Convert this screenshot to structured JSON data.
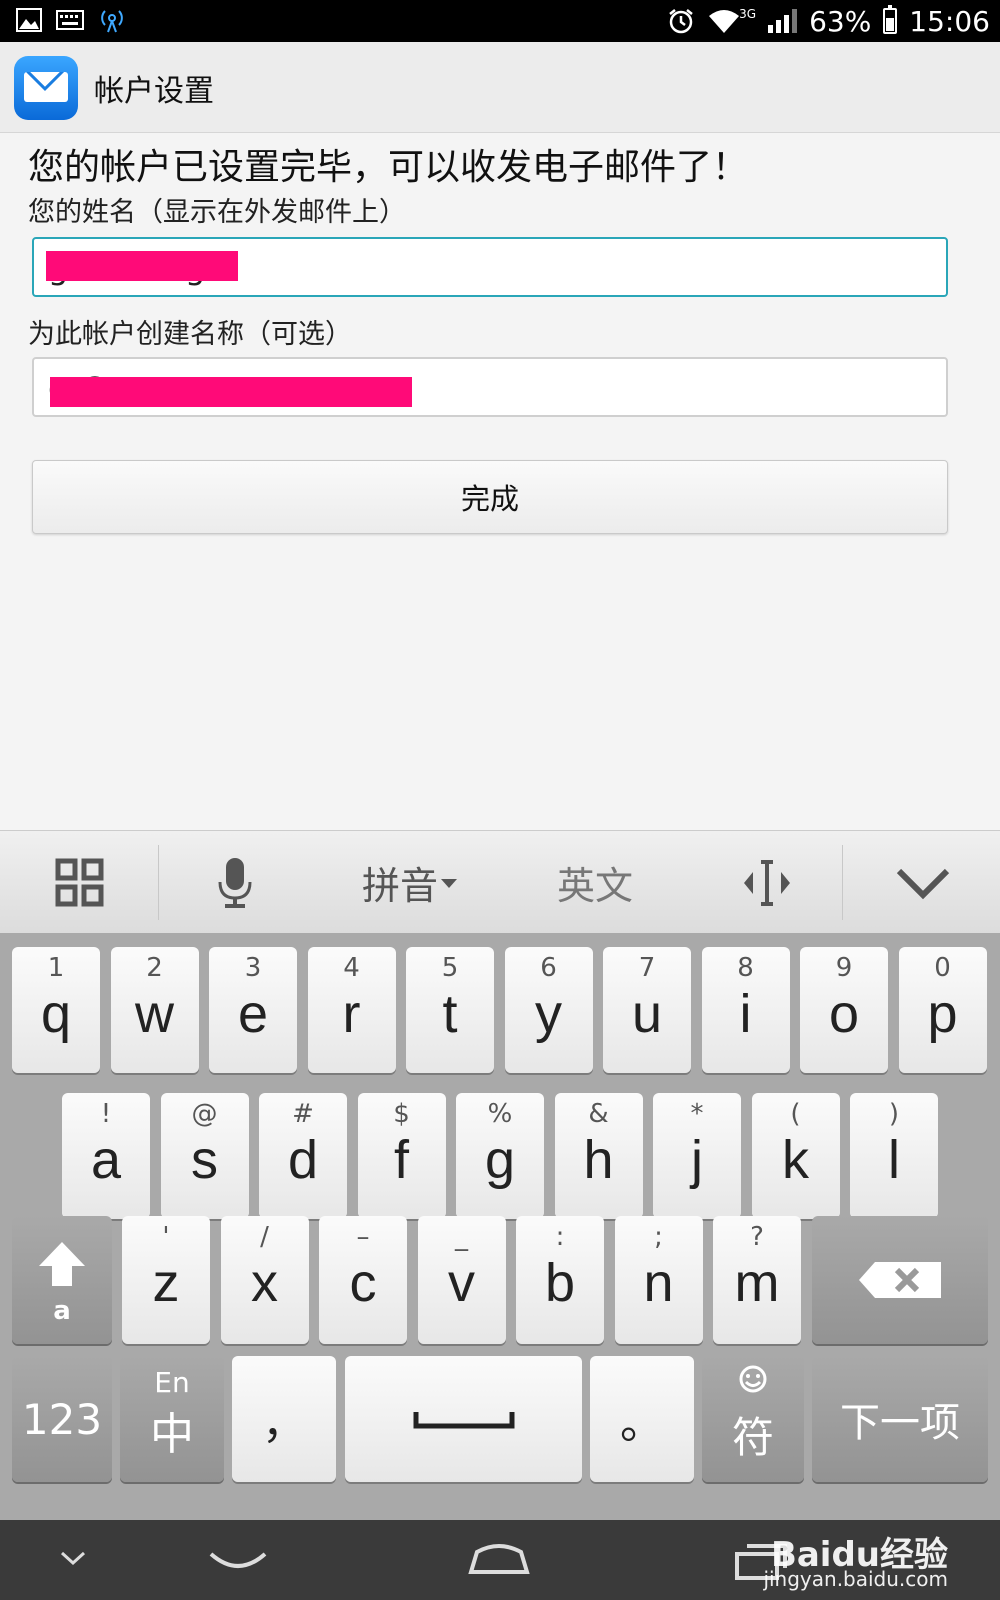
{
  "status_bar": {
    "network": "3G",
    "battery": "63%",
    "battery_level": 0.63,
    "time": "15:06"
  },
  "header": {
    "title": "帐户设置"
  },
  "main": {
    "headline": "您的帐户已设置完毕，可以收发电子邮件了！",
    "name_label": "您的姓名（显示在外发邮件上）",
    "name_value": "gaimixing",
    "account_label": "为此帐户创建名称（可选）",
    "account_value": "g          @",
    "done_button": "完成"
  },
  "ime_toolbar": {
    "pinyin": "拼音",
    "english": "英文"
  },
  "keyboard": {
    "row1": [
      {
        "sup": "1",
        "main": "q"
      },
      {
        "sup": "2",
        "main": "w"
      },
      {
        "sup": "3",
        "main": "e"
      },
      {
        "sup": "4",
        "main": "r"
      },
      {
        "sup": "5",
        "main": "t"
      },
      {
        "sup": "6",
        "main": "y"
      },
      {
        "sup": "7",
        "main": "u"
      },
      {
        "sup": "8",
        "main": "i"
      },
      {
        "sup": "9",
        "main": "o"
      },
      {
        "sup": "0",
        "main": "p"
      }
    ],
    "row2": [
      {
        "sup": "!",
        "main": "a"
      },
      {
        "sup": "@",
        "main": "s"
      },
      {
        "sup": "#",
        "main": "d"
      },
      {
        "sup": "$",
        "main": "f"
      },
      {
        "sup": "%",
        "main": "g"
      },
      {
        "sup": "&",
        "main": "h"
      },
      {
        "sup": "*",
        "main": "j"
      },
      {
        "sup": "(",
        "main": "k"
      },
      {
        "sup": ")",
        "main": "l"
      }
    ],
    "row3": [
      {
        "sup": "'",
        "main": "z"
      },
      {
        "sup": "/",
        "main": "x"
      },
      {
        "sup": "–",
        "main": "c"
      },
      {
        "sup": "_",
        "main": "v"
      },
      {
        "sup": ":",
        "main": "b"
      },
      {
        "sup": ";",
        "main": "n"
      },
      {
        "sup": "?",
        "main": "m"
      }
    ],
    "shift_label": "a",
    "num_key": "123",
    "lang_top": "En",
    "lang_main": "中",
    "comma": "，",
    "period": "。",
    "symbol_key": "符",
    "next_key": "下一项"
  },
  "watermark": {
    "brand": "Baidu经验",
    "url": "jingyan.baidu.com"
  }
}
